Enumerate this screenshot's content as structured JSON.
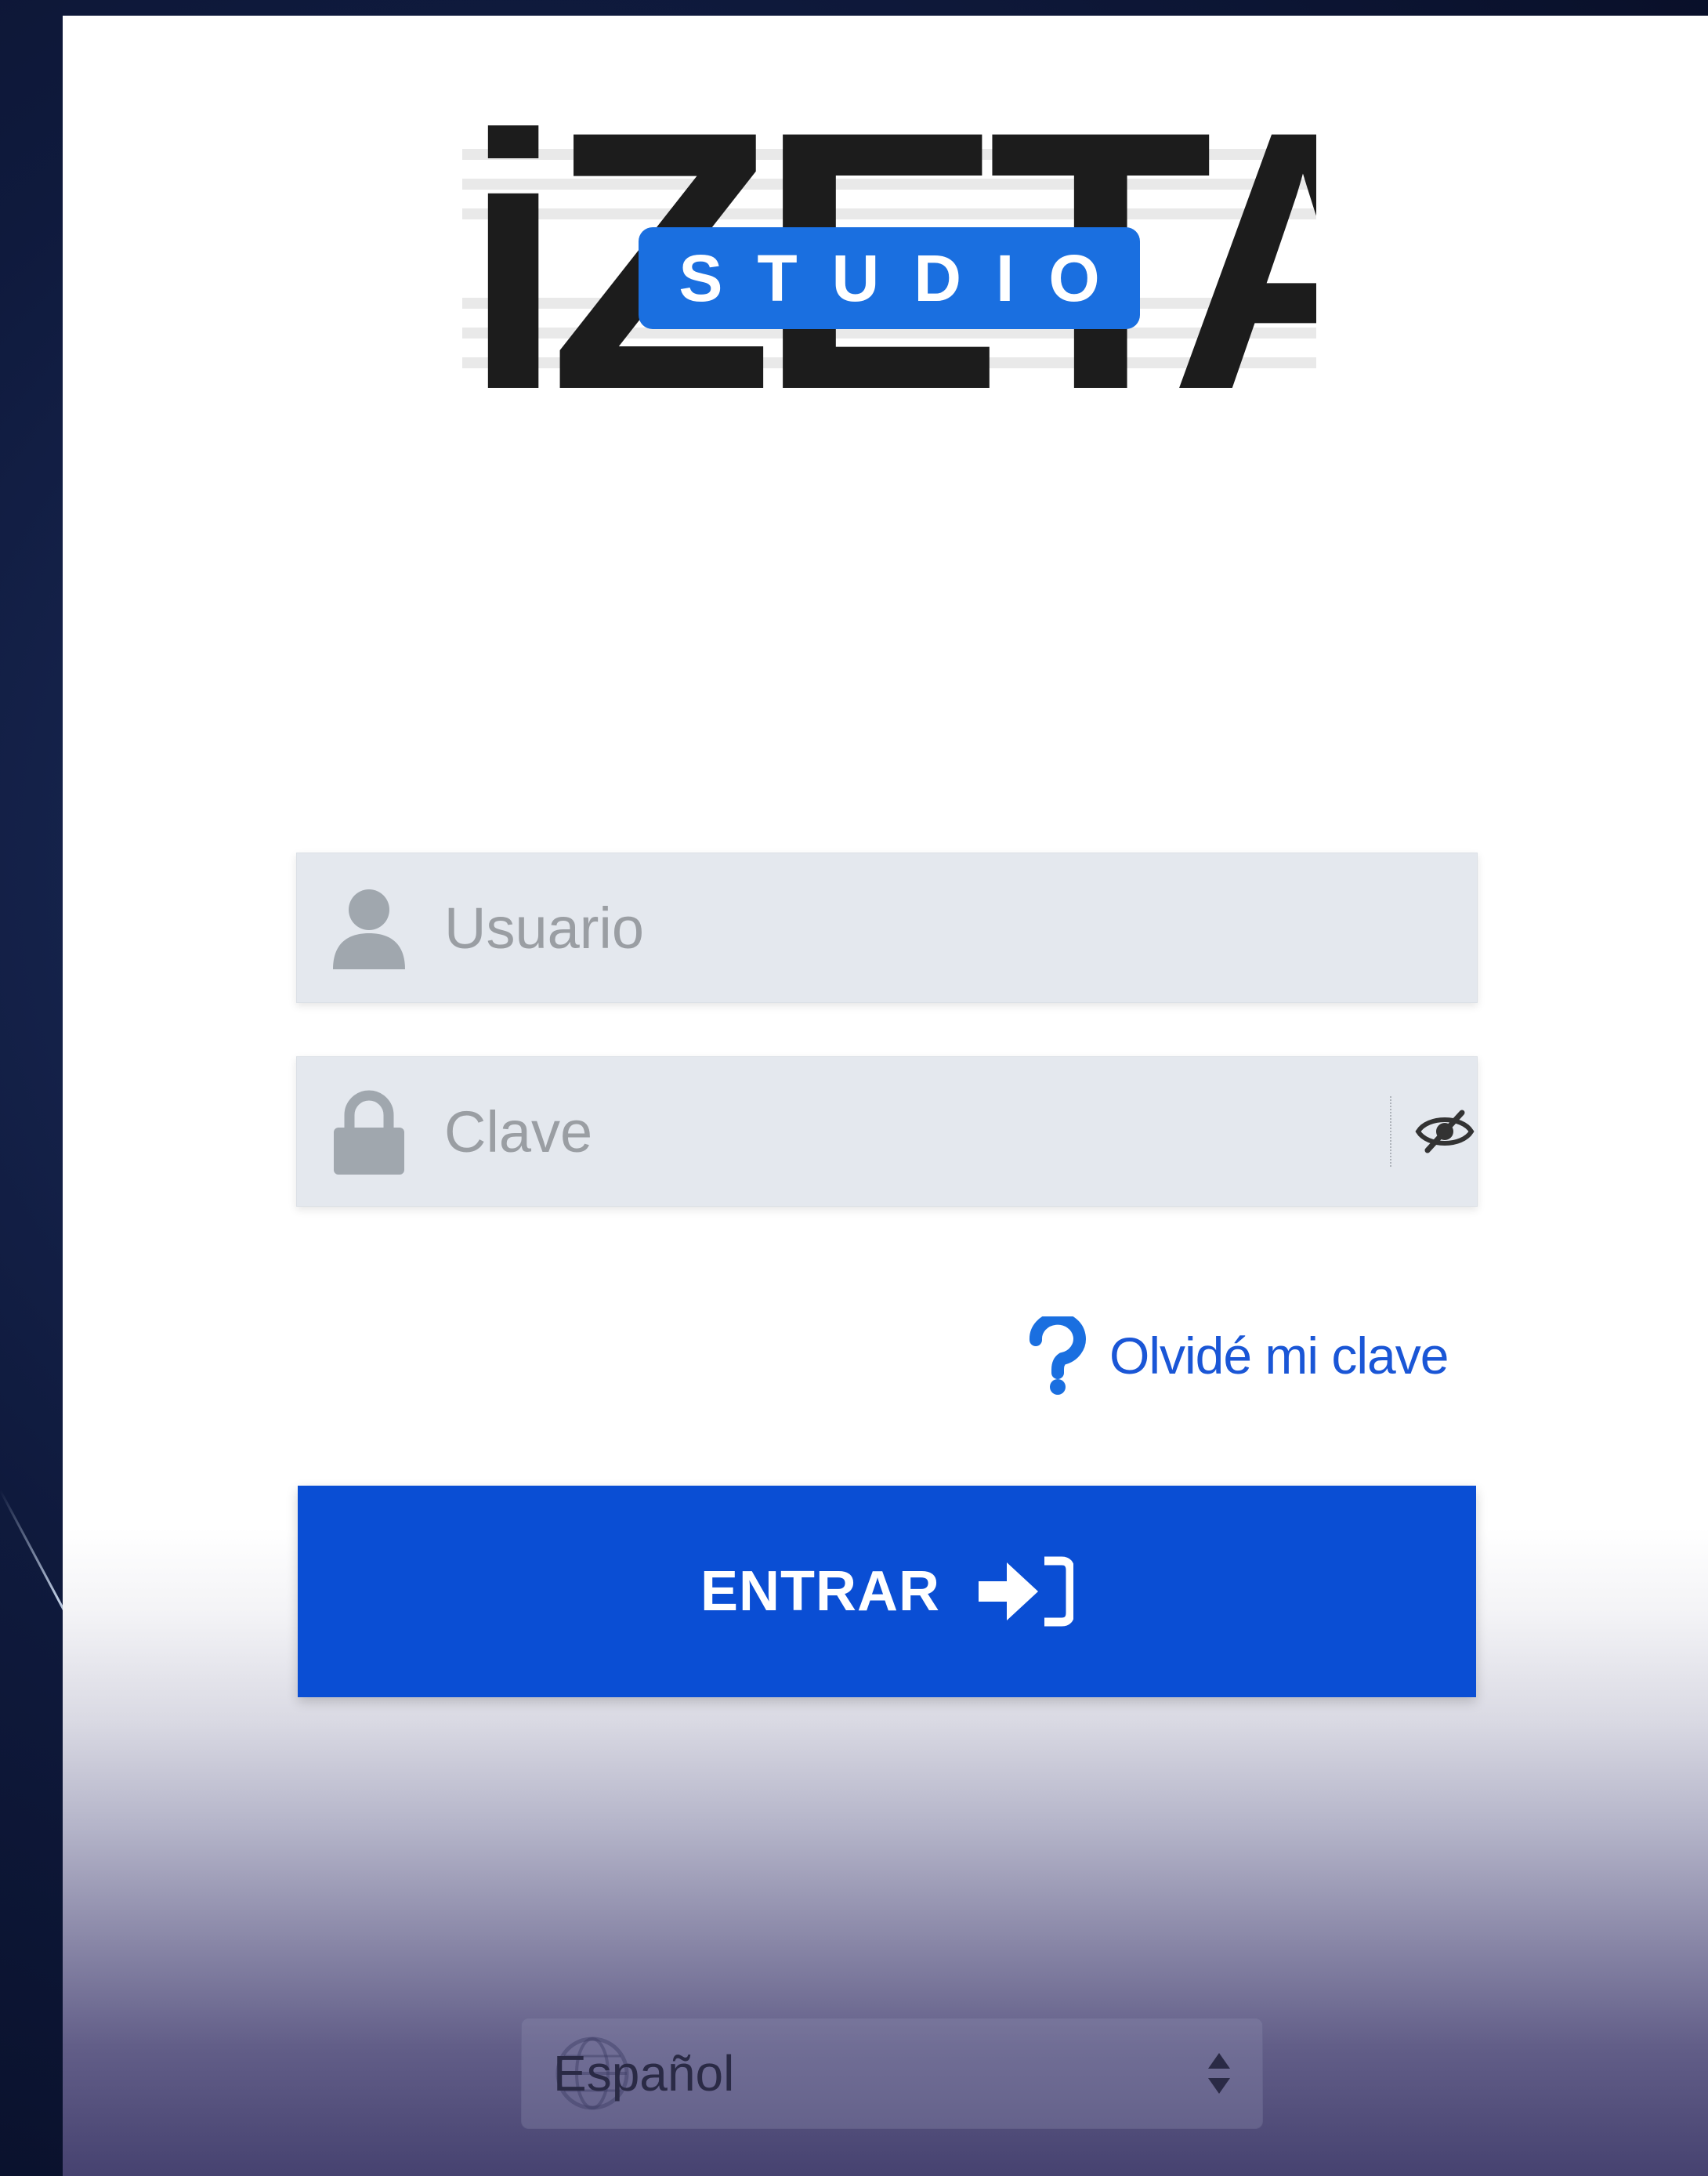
{
  "brand": {
    "wordmark": "iZETA",
    "badge": "STUDIO"
  },
  "login": {
    "username_placeholder": "Usuario",
    "username_value": "",
    "password_placeholder": "Clave",
    "password_value": "",
    "forgot_label": "Olvidé mi clave",
    "submit_label": "ENTRAR"
  },
  "language": {
    "selected": "Español"
  },
  "icons": {
    "username": "user-icon",
    "password": "lock-icon",
    "toggle_password": "eye-slash-icon",
    "forgot": "question-icon",
    "submit": "sign-in-icon",
    "language": "globe-icon",
    "select": "sort-arrows-icon"
  },
  "colors": {
    "primary": "#0a4ed4",
    "link": "#1a56d6",
    "badge": "#1a6fe0",
    "field_bg": "#e4e8ee",
    "background": "#0f1a3d"
  }
}
